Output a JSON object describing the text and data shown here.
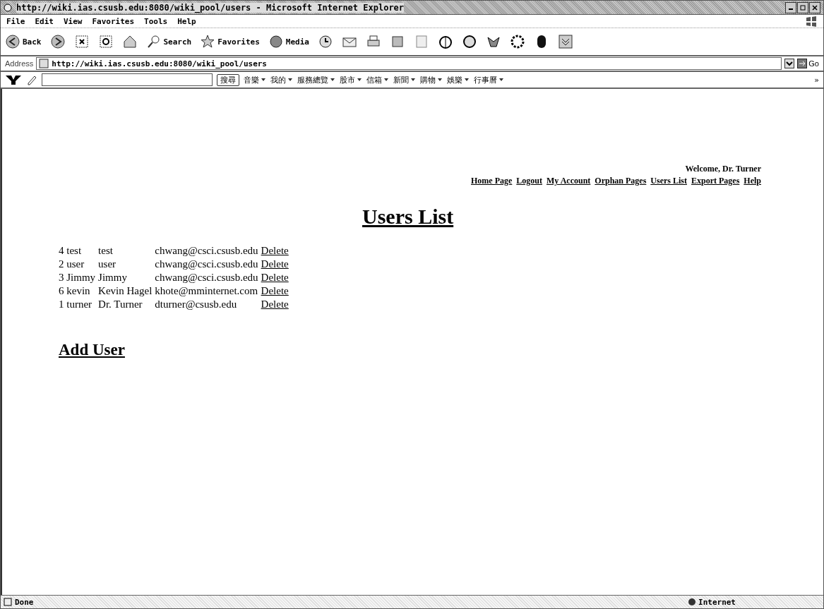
{
  "window": {
    "title": "http://wiki.ias.csusb.edu:8080/wiki_pool/users - Microsoft Internet Explorer"
  },
  "menu": [
    "File",
    "Edit",
    "View",
    "Favorites",
    "Tools",
    "Help"
  ],
  "toolbar": {
    "back": "Back",
    "search": "Search",
    "favorites": "Favorites",
    "media": "Media"
  },
  "address_bar": {
    "label": "Address",
    "url": "http://wiki.ias.csusb.edu:8080/wiki_pool/users",
    "go": "Go"
  },
  "yahoo_toolbar": {
    "search_button": "搜尋",
    "items": [
      "音樂",
      "我的",
      "服務總覽",
      "股市",
      "信箱",
      "新聞",
      "購物",
      "娛樂",
      "行事曆"
    ],
    "more": "»"
  },
  "page": {
    "welcome": "Welcome, Dr. Turner",
    "nav": [
      "Home Page",
      "Logout",
      "My Account",
      "Orphan Pages",
      "Users List",
      "Export Pages",
      "Help"
    ],
    "heading": "Users List",
    "users": [
      {
        "user": "4 test",
        "name": "test",
        "email": "chwang@csci.csusb.edu",
        "action": "Delete"
      },
      {
        "user": "2 user",
        "name": "user",
        "email": "chwang@csci.csusb.edu",
        "action": "Delete"
      },
      {
        "user": "3 Jimmy",
        "name": "Jimmy",
        "email": "chwang@csci.csusb.edu",
        "action": "Delete"
      },
      {
        "user": "6 kevin",
        "name": "Kevin Hagel",
        "email": "khote@mminternet.com",
        "action": "Delete"
      },
      {
        "user": "1 turner",
        "name": "Dr. Turner",
        "email": "dturner@csusb.edu",
        "action": "Delete"
      }
    ],
    "add_link": "Add User"
  },
  "status_bar": {
    "status": "Done",
    "zone": "Internet"
  }
}
